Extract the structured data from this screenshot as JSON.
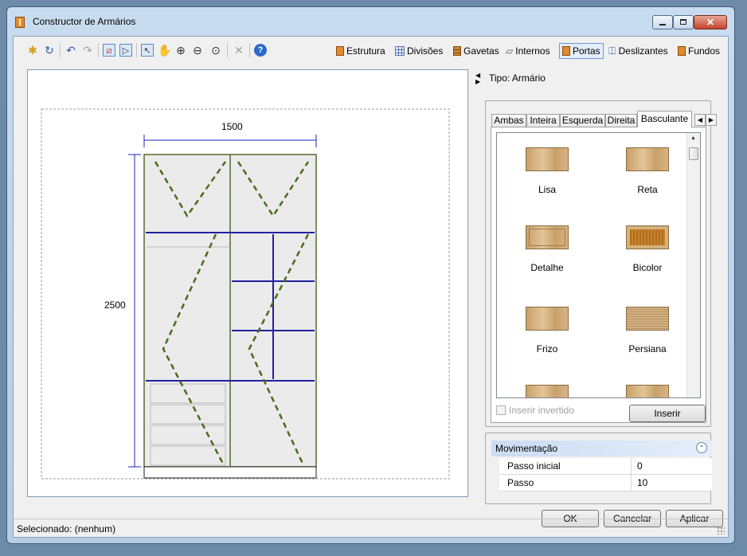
{
  "window": {
    "title": "Constructor de Armários"
  },
  "toolbar": {
    "modules": [
      {
        "label": "Estrutura",
        "icon": "structure-icon",
        "color": "#e58a2b"
      },
      {
        "label": "Divisões",
        "icon": "grid-icon",
        "color": "#5577bb"
      },
      {
        "label": "Gavetas",
        "icon": "drawers-icon",
        "color": "#cc8833"
      },
      {
        "label": "Internos",
        "icon": "internals-icon",
        "color": "#555555"
      },
      {
        "label": "Portas",
        "icon": "door-icon",
        "color": "#e58a2b",
        "active": true
      },
      {
        "label": "Deslizantes",
        "icon": "sliding-icon",
        "color": "#2a5fa8"
      },
      {
        "label": "Fundos",
        "icon": "back-panel-icon",
        "color": "#e58a2b"
      }
    ]
  },
  "drawing": {
    "width_label": "1500",
    "height_label": "2500"
  },
  "panel": {
    "tipo": "Tipo: Armário",
    "tabs": [
      "Ambas",
      "Inteira",
      "Esquerda",
      "Direita",
      "Basculante"
    ],
    "active_tab": "Basculante",
    "items": [
      {
        "label": "Lisa",
        "style": "plain"
      },
      {
        "label": "Reta",
        "style": "plain"
      },
      {
        "label": "Detalhe",
        "style": "detail"
      },
      {
        "label": "Bicolor",
        "style": "bicolor"
      },
      {
        "label": "Frizo",
        "style": "plain"
      },
      {
        "label": "Persiana",
        "style": "louver"
      },
      {
        "label": "",
        "style": "plain"
      },
      {
        "label": "",
        "style": "plain"
      }
    ],
    "invert_label": "Inserir invertido",
    "insert_label": "Inserir"
  },
  "movement": {
    "title": "Movimentação",
    "props": [
      {
        "key": "Passo inicial",
        "value": "0"
      },
      {
        "key": "Passo",
        "value": "10"
      }
    ]
  },
  "buttons": {
    "ok": "OK",
    "cancel": "Cancelar",
    "apply": "Aplicar"
  },
  "status": {
    "text": "Selecionado: (nenhum)"
  }
}
